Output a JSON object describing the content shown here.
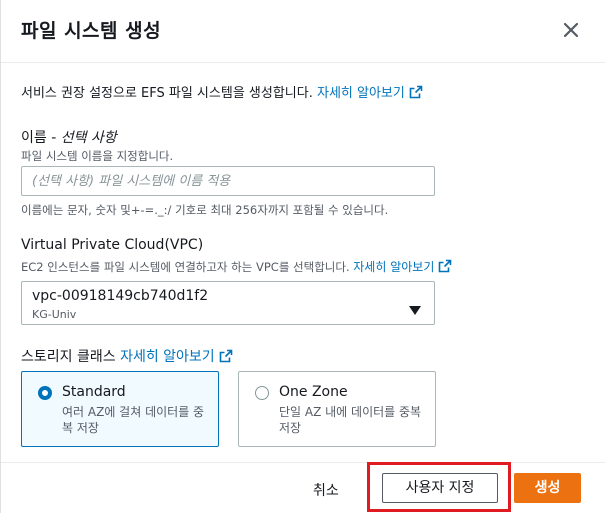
{
  "modal": {
    "title": "파일 시스템 생성",
    "close_icon": "close-icon"
  },
  "intro": {
    "text": "서비스 권장 설정으로 EFS 파일 시스템을 생성합니다.",
    "link": "자세히 알아보기",
    "link_icon": "external-link-icon"
  },
  "name_field": {
    "label": "이름 - ",
    "label_optional": "선택 사항",
    "description": "파일 시스템 이름을 지정합니다.",
    "placeholder": "(선택 사항) 파일 시스템에 이름 적용",
    "value": "",
    "constraint": "이름에는 문자, 숫자 및+-=._:/ 기호로 최대 256자까지 포함될 수 있습니다."
  },
  "vpc_field": {
    "label": "Virtual Private Cloud(VPC)",
    "description": "EC2 인스턴스를 파일 시스템에 연결하고자 하는 VPC를 선택합니다.",
    "link": "자세히 알아보기",
    "selected_id": "vpc-00918149cb740d1f2",
    "selected_name": "KG-Univ",
    "caret_icon": "caret-down-icon"
  },
  "storage_class": {
    "label": "스토리지 클래스",
    "link": "자세히 알아보기",
    "options": [
      {
        "title": "Standard",
        "description": "여러 AZ에 걸쳐 데이터를 중복 저장",
        "selected": true
      },
      {
        "title": "One Zone",
        "description": "단일 AZ 내에 데이터를 중복 저장",
        "selected": false
      }
    ]
  },
  "footer": {
    "cancel": "취소",
    "customize": "사용자 지정",
    "create": "생성"
  },
  "colors": {
    "link": "#0073bb",
    "primary": "#ec7211",
    "highlight": "#e11b22",
    "selected_bg": "#f1faff"
  }
}
